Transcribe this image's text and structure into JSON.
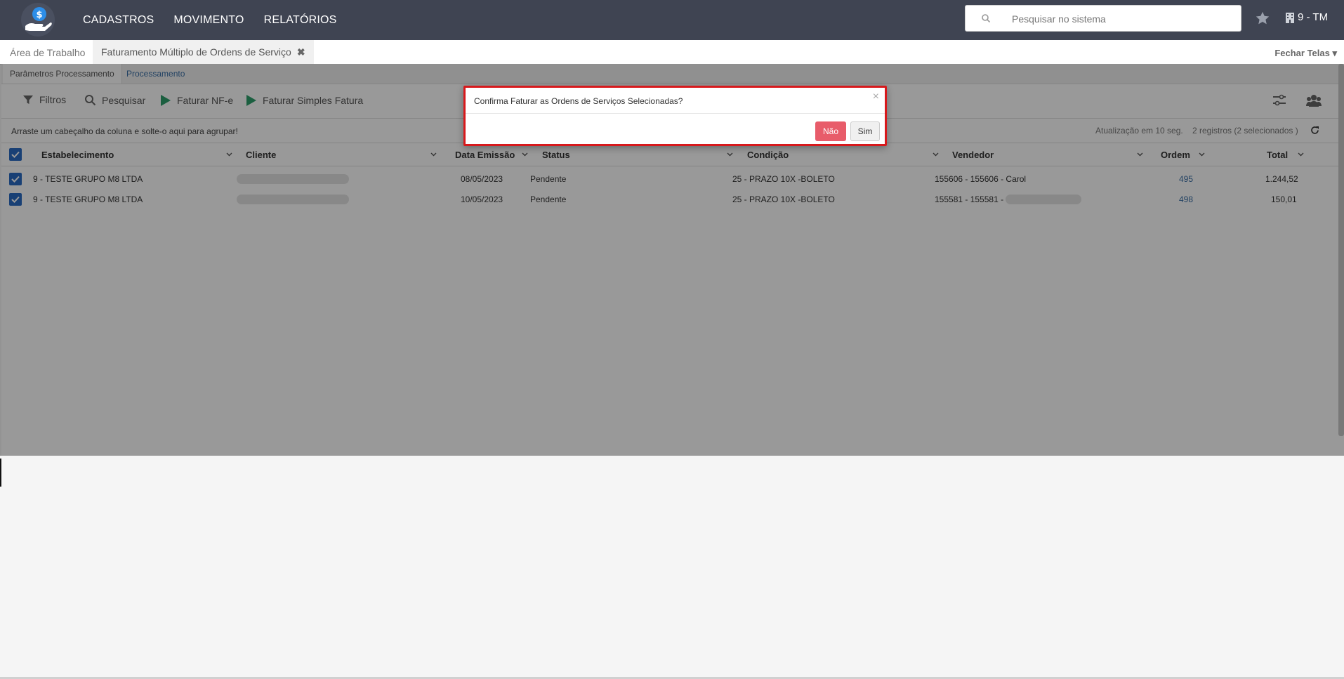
{
  "topbar": {
    "menu": [
      "CADASTROS",
      "MOVIMENTO",
      "RELATÓRIOS"
    ],
    "search_placeholder": "Pesquisar no sistema",
    "company": "9 - TM"
  },
  "tabs": {
    "area": "Área de Trabalho",
    "active": "Faturamento Múltiplo de Ordens de Serviço",
    "close_all": "Fechar Telas"
  },
  "subtabs": [
    "Parâmetros Processamento",
    "Processamento"
  ],
  "toolbar": {
    "filtros": "Filtros",
    "pesquisar": "Pesquisar",
    "faturar_nfe": "Faturar NF-e",
    "faturar_simples": "Faturar Simples Fatura"
  },
  "grid": {
    "group_hint": "Arraste um cabeçalho da coluna e solte-o aqui para agrupar!",
    "refresh_info": "Atualização em 10 seg.",
    "records_info": "2 registros (2 selecionados )",
    "columns": [
      "Estabelecimento",
      "Cliente",
      "Data Emissão",
      "Status",
      "Condição",
      "Vendedor",
      "Ordem",
      "Total"
    ],
    "rows": [
      {
        "estabelecimento": "9 - TESTE GRUPO M8 LTDA",
        "data": "08/05/2023",
        "status": "Pendente",
        "condicao": "25 - PRAZO 10X -BOLETO",
        "vendedor": "155606 - 155606 - Carol",
        "ordem": "495",
        "total": "1.244,52"
      },
      {
        "estabelecimento": "9 - TESTE GRUPO M8 LTDA",
        "data": "10/05/2023",
        "status": "Pendente",
        "condicao": "25 - PRAZO 10X -BOLETO",
        "vendedor": "155581 - 155581 -",
        "ordem": "498",
        "total": "150,01"
      }
    ]
  },
  "modal": {
    "message": "Confirma Faturar as Ordens de Serviços Selecionadas?",
    "close": "×",
    "no": "Não",
    "yes": "Sim"
  },
  "colors": {
    "topbar": "#3f4452",
    "accent": "#2b6cc4",
    "danger": "#e85c6a",
    "play": "#2e9e6b"
  }
}
